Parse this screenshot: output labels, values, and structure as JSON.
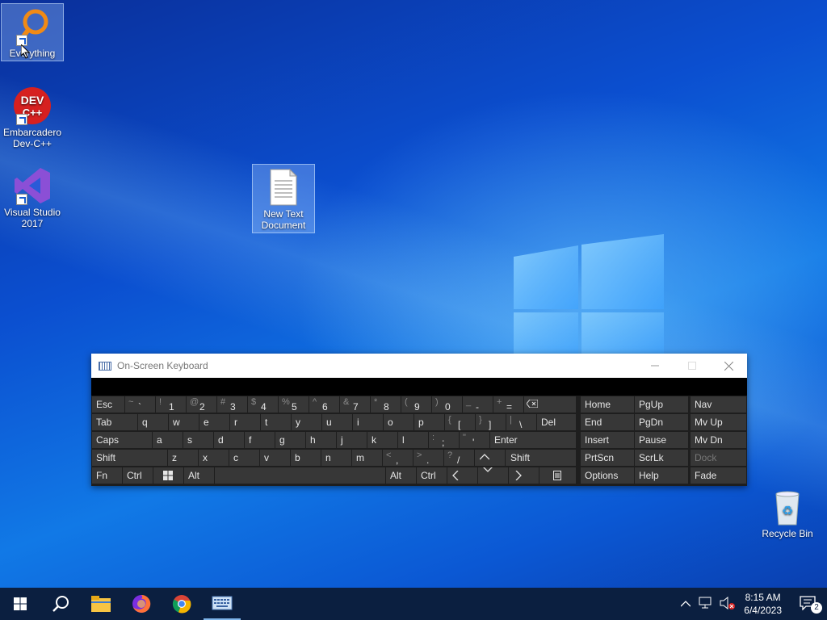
{
  "desktop": {
    "icons": [
      {
        "label": "Everything"
      },
      {
        "label": "Embarcadero Dev-C++",
        "logo_text": "DEV C++"
      },
      {
        "label": "Visual Studio 2017"
      },
      {
        "label": "New Text Document"
      },
      {
        "label": "Recycle Bin"
      }
    ]
  },
  "osk": {
    "title": "On-Screen Keyboard",
    "keys": {
      "esc": "Esc",
      "tab": "Tab",
      "caps": "Caps",
      "shift": "Shift",
      "fn": "Fn",
      "ctrl": "Ctrl",
      "alt": "Alt",
      "del": "Del",
      "enter": "Enter",
      "rshift": "Shift",
      "ralt": "Alt",
      "rctrl": "Ctrl",
      "home": "Home",
      "pgup": "PgUp",
      "nav": "Nav",
      "end": "End",
      "pgdn": "PgDn",
      "mvup": "Mv Up",
      "insert": "Insert",
      "pause": "Pause",
      "mvdn": "Mv Dn",
      "prtscn": "PrtScn",
      "scrlk": "ScrLk",
      "dock": "Dock",
      "options": "Options",
      "help": "Help",
      "fade": "Fade"
    },
    "num_row": [
      {
        "s": "~",
        "m": "`"
      },
      {
        "s": "!",
        "m": "1"
      },
      {
        "s": "@",
        "m": "2"
      },
      {
        "s": "#",
        "m": "3"
      },
      {
        "s": "$",
        "m": "4"
      },
      {
        "s": "%",
        "m": "5"
      },
      {
        "s": "^",
        "m": "6"
      },
      {
        "s": "&",
        "m": "7"
      },
      {
        "s": "*",
        "m": "8"
      },
      {
        "s": "(",
        "m": "9"
      },
      {
        "s": ")",
        "m": "0"
      },
      {
        "s": "_",
        "m": "-"
      },
      {
        "s": "+",
        "m": "="
      }
    ],
    "row_q": [
      "q",
      "w",
      "e",
      "r",
      "t",
      "y",
      "u",
      "i",
      "o",
      "p"
    ],
    "row_q_sym": [
      {
        "s": "{",
        "m": "["
      },
      {
        "s": "}",
        "m": "]"
      },
      {
        "s": "|",
        "m": "\\"
      }
    ],
    "row_a": [
      "a",
      "s",
      "d",
      "f",
      "g",
      "h",
      "j",
      "k",
      "l"
    ],
    "row_a_sym": [
      {
        "s": ":",
        "m": ";"
      },
      {
        "s": "\"",
        "m": "'"
      }
    ],
    "row_z": [
      "z",
      "x",
      "c",
      "v",
      "b",
      "n",
      "m"
    ],
    "row_z_sym": [
      {
        "s": "<",
        "m": ","
      },
      {
        "s": ">",
        "m": "."
      },
      {
        "s": "?",
        "m": "/"
      }
    ]
  },
  "taskbar": {
    "time": "8:15 AM",
    "date": "6/4/2023",
    "notifications": "2"
  }
}
